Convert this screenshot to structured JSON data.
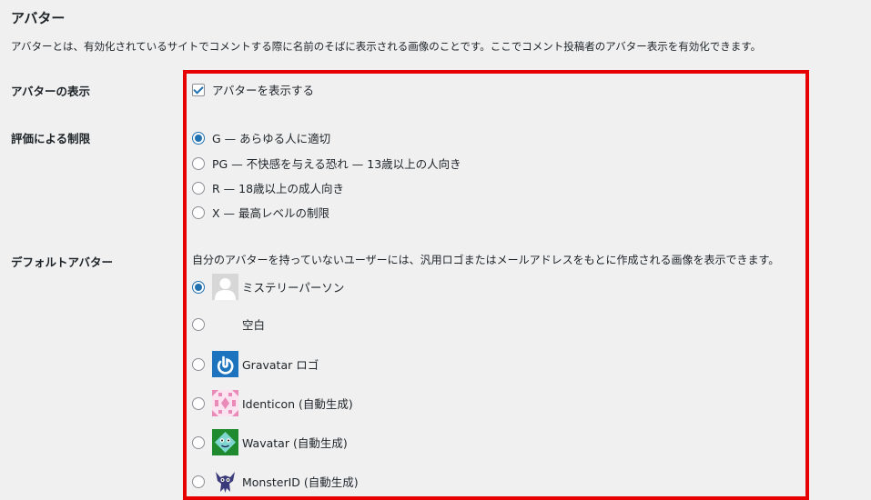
{
  "section": {
    "title": "アバター",
    "description": "アバターとは、有効化されているサイトでコメントする際に名前のそばに表示される画像のことです。ここでコメント投稿者のアバター表示を有効化できます。"
  },
  "show_avatars": {
    "label": "アバターの表示",
    "checkbox_label": "アバターを表示する",
    "checked": true
  },
  "rating": {
    "label": "評価による制限",
    "options": [
      {
        "label": "G — あらゆる人に適切",
        "selected": true
      },
      {
        "label": "PG — 不快感を与える恐れ — 13歳以上の人向き",
        "selected": false
      },
      {
        "label": "R — 18歳以上の成人向き",
        "selected": false
      },
      {
        "label": "X — 最高レベルの制限",
        "selected": false
      }
    ]
  },
  "default_avatar": {
    "label": "デフォルトアバター",
    "description": "自分のアバターを持っていないユーザーには、汎用ロゴまたはメールアドレスをもとに作成される画像を表示できます。",
    "options": [
      {
        "label": "ミステリーパーソン",
        "icon": "mystery-person-avatar",
        "selected": true
      },
      {
        "label": "空白",
        "icon": "blank-avatar",
        "selected": false
      },
      {
        "label": "Gravatar ロゴ",
        "icon": "gravatar-logo-avatar",
        "selected": false
      },
      {
        "label": "Identicon (自動生成)",
        "icon": "identicon-avatar",
        "selected": false
      },
      {
        "label": "Wavatar (自動生成)",
        "icon": "wavatar-avatar",
        "selected": false
      },
      {
        "label": "MonsterID (自動生成)",
        "icon": "monsterid-avatar",
        "selected": false
      }
    ]
  },
  "colors": {
    "accent": "#2271b1",
    "highlight_border": "#e60000",
    "background": "#f0f0f1"
  }
}
